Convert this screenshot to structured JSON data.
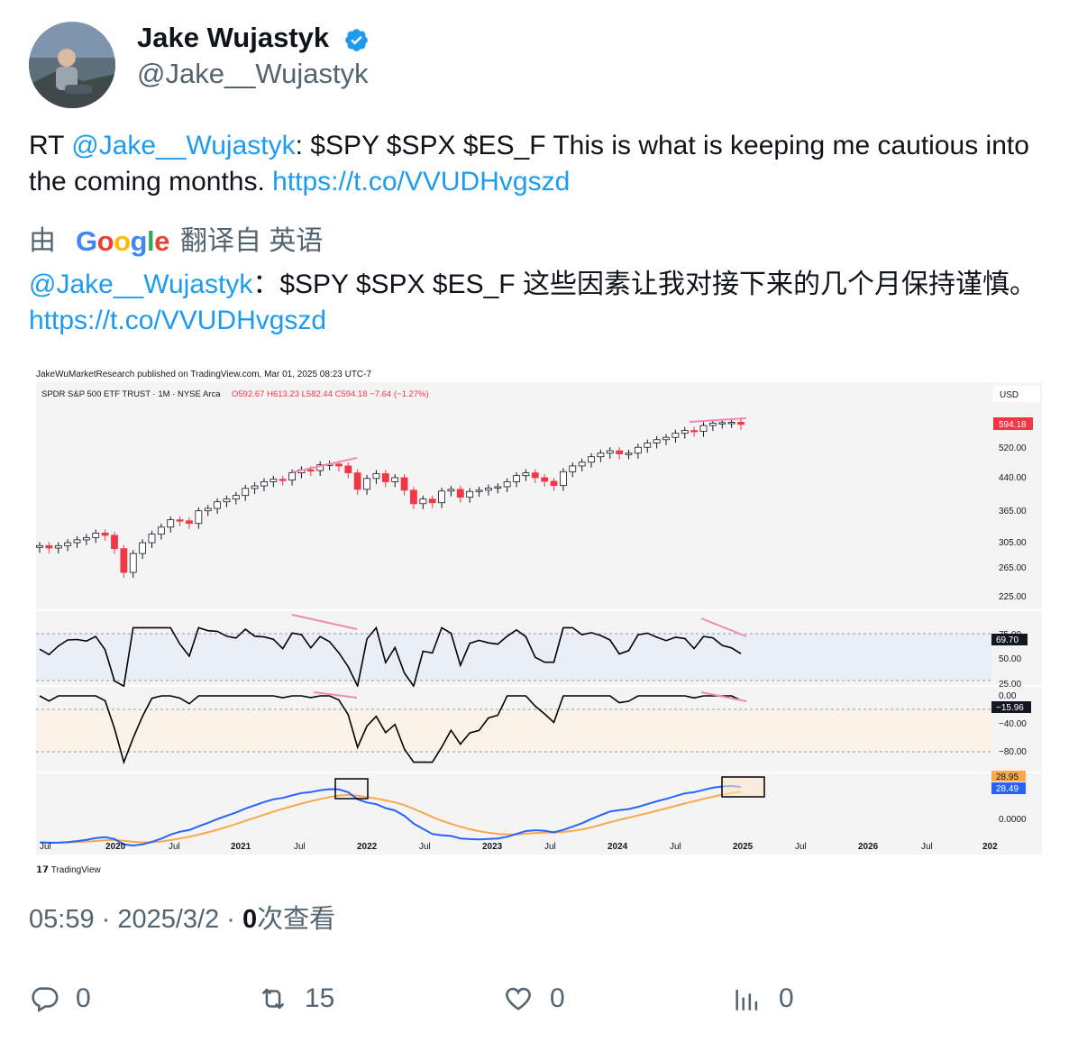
{
  "author": {
    "name": "Jake Wujastyk",
    "handle": "@Jake__Wujastyk"
  },
  "tweet": {
    "prefix": "RT ",
    "mention": "@Jake__Wujastyk",
    "body": ": $SPY $SPX $ES_F This is what is keeping me cautious into the coming months. ",
    "link": "https://t.co/VVUDHvgszd"
  },
  "translation": {
    "by_label": "由",
    "provider": "Google",
    "from_label": "翻译自 英语",
    "mention": "@Jake__Wujastyk",
    "body": "：$SPY $SPX $ES_F 这些因素让我对接下来的几个月保持谨慎。",
    "link": "https://t.co/VVUDHvgszd"
  },
  "chart_data": {
    "type": "candlestick",
    "publisher_line": "JakeWuMarketResearch published on TradingView.com, Mar 01, 2025 08:23 UTC-7",
    "symbol_line": "SPDR S&P 500 ETF TRUST · 1M · NYSE Arca",
    "ohlc": {
      "O": "592.67",
      "H": "613.23",
      "L": "582.44",
      "C": "594.18",
      "change": "−7.64 (−1.27%)"
    },
    "currency": "USD",
    "last_price": "594.18",
    "price_ticks": [
      "520.00",
      "440.00",
      "365.00",
      "305.00",
      "265.00",
      "225.00"
    ],
    "rsi_ticks": [
      "75.00",
      "50.00",
      "25.00"
    ],
    "rsi_value": "69.70",
    "osc_ticks": [
      "0.00",
      "−40.00",
      "−80.00"
    ],
    "osc_value": "−15.96",
    "macd_ticks": [
      "0.0000"
    ],
    "macd_values": [
      "28.95",
      "28.49"
    ],
    "x_ticks": [
      "Jul",
      "2020",
      "Jul",
      "2021",
      "Jul",
      "2022",
      "Jul",
      "2023",
      "Jul",
      "2024",
      "Jul",
      "2025",
      "Jul",
      "2026",
      "Jul",
      "202"
    ],
    "closes": [
      300,
      296,
      300,
      305,
      310,
      314,
      322,
      318,
      295,
      258,
      287,
      305,
      320,
      333,
      347,
      345,
      340,
      365,
      370,
      384,
      390,
      398,
      414,
      420,
      430,
      436,
      434,
      452,
      460,
      458,
      473,
      475,
      470,
      452,
      412,
      438,
      450,
      430,
      440,
      410,
      380,
      390,
      382,
      408,
      412,
      394,
      407,
      410,
      415,
      418,
      430,
      445,
      452,
      440,
      431,
      421,
      455,
      470,
      480,
      495,
      505,
      512,
      503,
      505,
      522,
      535,
      545,
      552,
      565,
      574,
      571,
      590,
      598,
      600,
      601,
      594
    ],
    "colors": {
      "up": "#ffffff",
      "down": "#f23645",
      "divergence": "#f08ab0",
      "rsi_line": "#000000",
      "macd_fast": "#2962ff",
      "macd_slow": "#f7a94b"
    },
    "footer": "TradingView"
  },
  "meta": {
    "time": "05:59",
    "date": "2025/3/2",
    "views_count": "0",
    "views_label": "次查看"
  },
  "actions": {
    "reply_count": "0",
    "retweet_count": "15",
    "like_count": "0",
    "views_count": "0"
  }
}
